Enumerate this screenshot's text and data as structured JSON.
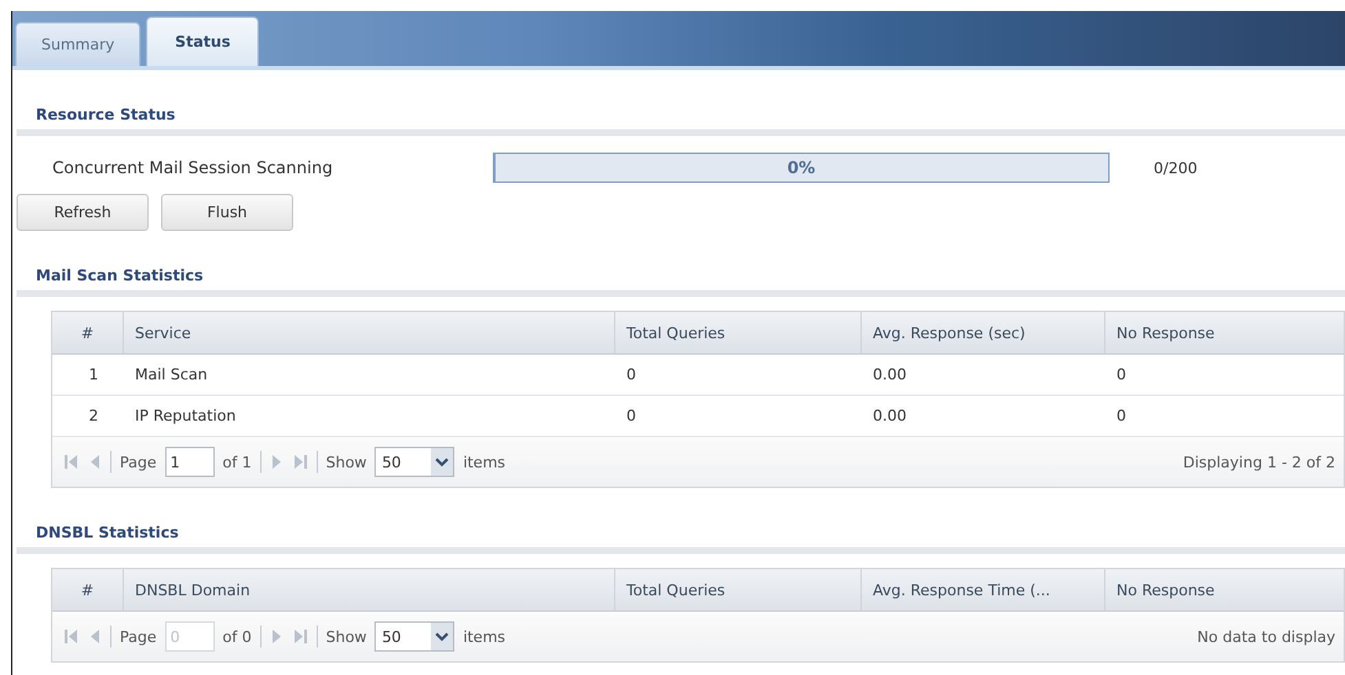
{
  "tabs": [
    {
      "label": "Summary",
      "selected": false
    },
    {
      "label": "Status",
      "selected": true
    }
  ],
  "resource_status": {
    "title": "Resource Status",
    "rows": [
      {
        "label": "Concurrent Mail Session Scanning",
        "level": 0,
        "percent": "0%",
        "count": "0/200"
      }
    ],
    "buttons": [
      "Refresh",
      "Flush"
    ]
  },
  "sections": [
    {
      "title": "Mail Scan Statistics",
      "columns": [
        "#",
        "Service",
        "Total Queries",
        "Avg. Response (sec)",
        "No Response"
      ],
      "rows": [
        [
          "1",
          "Mail Scan",
          "0",
          "0.00",
          "0"
        ],
        [
          "2",
          "IP Reputation",
          "0",
          "0.00",
          "0"
        ]
      ],
      "pager": {
        "page_label": "Page",
        "page": "1",
        "page_disabled": false,
        "of": "of 1",
        "show_label": "Show",
        "show": "50",
        "items": "items",
        "display": "Displaying 1 - 2 of 2"
      }
    },
    {
      "title": "DNSBL Statistics",
      "columns": [
        "#",
        "DNSBL Domain",
        "Total Queries",
        "Avg. Response Time (...",
        "No Response"
      ],
      "pager": {
        "page_label": "Page",
        "page": "0",
        "page_disabled": true,
        "of": "of 0",
        "show_label": "Show",
        "show": "50",
        "items": "items",
        "display": "No data to display"
      }
    }
  ]
}
